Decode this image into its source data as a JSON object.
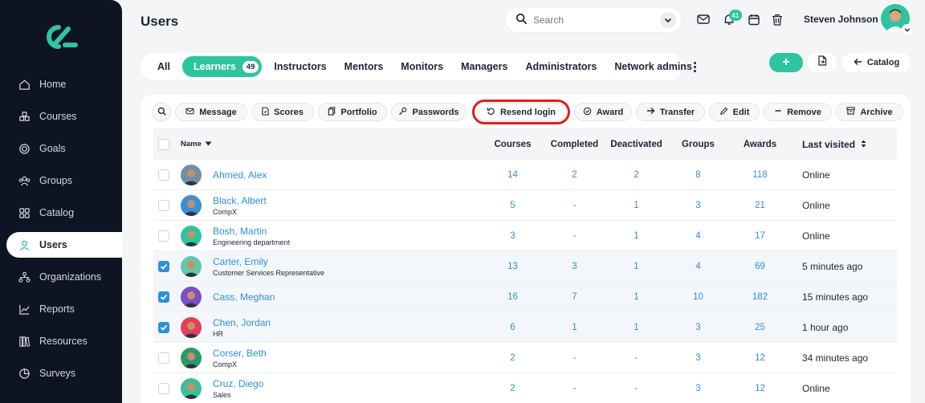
{
  "sidebar": {
    "items": [
      {
        "label": "Home",
        "icon": "home-icon"
      },
      {
        "label": "Courses",
        "icon": "courses-icon"
      },
      {
        "label": "Goals",
        "icon": "target-icon"
      },
      {
        "label": "Groups",
        "icon": "groups-icon"
      },
      {
        "label": "Catalog",
        "icon": "grid-icon"
      },
      {
        "label": "Users",
        "icon": "user-icon"
      },
      {
        "label": "Organizations",
        "icon": "org-icon"
      },
      {
        "label": "Reports",
        "icon": "chart-icon"
      },
      {
        "label": "Resources",
        "icon": "book-icon"
      },
      {
        "label": "Surveys",
        "icon": "pie-icon"
      }
    ],
    "active": "Users"
  },
  "header": {
    "title": "Users",
    "search_placeholder": "Search",
    "notification_count": "41",
    "user_name": "Steven Johnson"
  },
  "tabs": {
    "items": [
      "All",
      "Learners",
      "Instructors",
      "Mentors",
      "Monitors",
      "Managers",
      "Administrators",
      "Network admins"
    ],
    "active_count": "49",
    "catalog_label": "Catalog",
    "add_label": "+"
  },
  "toolbar": {
    "message": "Message",
    "scores": "Scores",
    "portfolio": "Portfolio",
    "passwords": "Passwords",
    "resend_login": "Resend login",
    "award": "Award",
    "transfer": "Transfer",
    "edit": "Edit",
    "remove": "Remove",
    "archive": "Archive"
  },
  "table": {
    "headers": {
      "name": "Name",
      "courses": "Courses",
      "completed": "Completed",
      "deactivated": "Deactivated",
      "groups": "Groups",
      "awards": "Awards",
      "last_visited": "Last visited"
    },
    "rows": [
      {
        "name": "Ahmed, Alex",
        "sub": "",
        "courses": "14",
        "completed": "2",
        "deactivated": "2",
        "groups": "8",
        "awards": "118",
        "last": "Online",
        "checked": false,
        "avatar": "#6f8fa8"
      },
      {
        "name": "Black, Albert",
        "sub": "CompX",
        "courses": "5",
        "completed": "-",
        "deactivated": "1",
        "groups": "3",
        "awards": "21",
        "last": "Online",
        "checked": false,
        "avatar": "#3a8fd6"
      },
      {
        "name": "Bosh, Martin",
        "sub": "Engineering department",
        "courses": "3",
        "completed": "-",
        "deactivated": "1",
        "groups": "4",
        "awards": "17",
        "last": "Online",
        "checked": false,
        "avatar": "#2ec4a0"
      },
      {
        "name": "Carter, Emily",
        "sub": "Customer Services Representative",
        "courses": "13",
        "completed": "3",
        "deactivated": "1",
        "groups": "4",
        "awards": "69",
        "last": "5 minutes ago",
        "checked": true,
        "avatar": "#5fc9a8"
      },
      {
        "name": "Cass, Meghan",
        "sub": "",
        "courses": "16",
        "completed": "7",
        "deactivated": "1",
        "groups": "10",
        "awards": "182",
        "last": "15 minutes ago",
        "checked": true,
        "avatar": "#7b4fc9"
      },
      {
        "name": "Chen, Jordan",
        "sub": "HR",
        "courses": "6",
        "completed": "1",
        "deactivated": "1",
        "groups": "3",
        "awards": "25",
        "last": "1 hour ago",
        "checked": true,
        "avatar": "#e0405a"
      },
      {
        "name": "Corser, Beth",
        "sub": "CompX",
        "courses": "2",
        "completed": "-",
        "deactivated": "-",
        "groups": "3",
        "awards": "12",
        "last": "34 minutes ago",
        "checked": false,
        "avatar": "#2a9a6a"
      },
      {
        "name": "Cruz, Diego",
        "sub": "Sales",
        "courses": "2",
        "completed": "-",
        "deactivated": "-",
        "groups": "3",
        "awards": "12",
        "last": "Online",
        "checked": false,
        "avatar": "#3bbf9a"
      }
    ]
  },
  "colors": {
    "accent": "#2ec4a0",
    "link": "#2e8fdc",
    "sidebar_bg": "#0f1424",
    "highlight_ring": "#e01e1e"
  }
}
